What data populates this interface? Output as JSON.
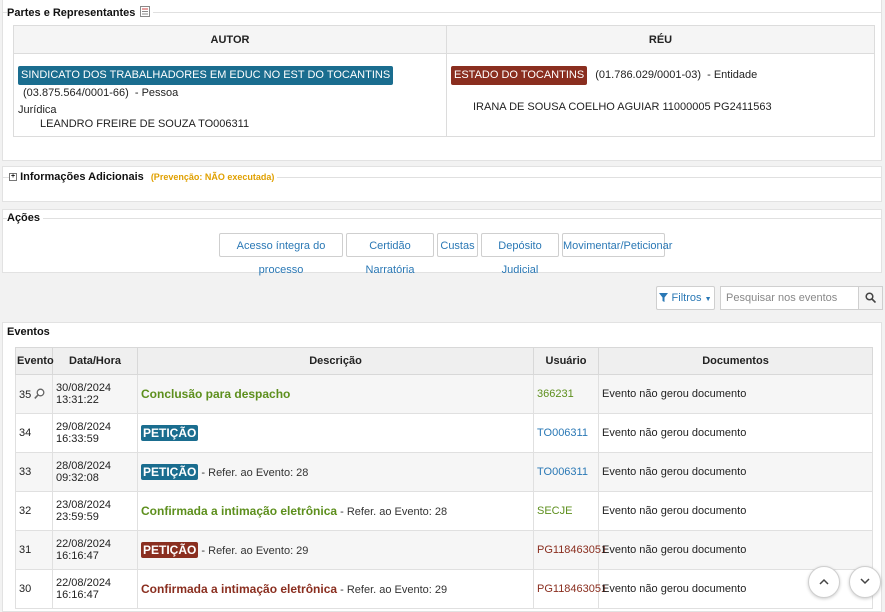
{
  "partes": {
    "title": "Partes e Representantes",
    "autor_header": "AUTOR",
    "reu_header": "RÉU",
    "autor": {
      "name": "SINDICATO DOS TRABALHADORES EM EDUC NO EST DO TOCANTINS",
      "doc": "(03.875.564/0001-66)",
      "type_part1": "- Pessoa",
      "type_part2": "Jurídica",
      "representative": "LEANDRO FREIRE DE SOUZA   TO006311"
    },
    "reu": {
      "name": "ESTADO DO TOCANTINS",
      "doc": "(01.786.029/0001-03)",
      "type": "- Entidade",
      "representative": "IRANA DE SOUSA COELHO AGUIAR   11000005   PG2411563"
    }
  },
  "info": {
    "title": "Informações Adicionais",
    "prevencao": "(Prevenção:  NÃO executada)"
  },
  "acoes": {
    "title": "Ações",
    "buttons": [
      "Acesso íntegra do processo",
      "Certidão Narratória",
      "Custas",
      "Depósito Judicial",
      "Movimentar/Peticionar"
    ]
  },
  "filters": {
    "label": "Filtros",
    "search_placeholder": "Pesquisar nos eventos"
  },
  "eventos": {
    "title": "Eventos",
    "headers": [
      "Evento",
      "Data/Hora",
      "Descrição",
      "Usuário",
      "Documentos"
    ],
    "rows": [
      {
        "num": "35",
        "date": "30/08/2024",
        "time": "13:31:22",
        "desc": "Conclusão para despacho",
        "refer": "",
        "user": "366231",
        "docs": "Evento não gerou documento"
      },
      {
        "num": "34",
        "date": "29/08/2024",
        "time": "16:33:59",
        "desc": "PETIÇÃO",
        "refer": "",
        "user": "TO006311",
        "docs": "Evento não gerou documento"
      },
      {
        "num": "33",
        "date": "28/08/2024",
        "time": "09:32:08",
        "desc": "PETIÇÃO",
        "refer": "- Refer. ao Evento: 28",
        "user": "TO006311",
        "docs": "Evento não gerou documento"
      },
      {
        "num": "32",
        "date": "23/08/2024",
        "time": "23:59:59",
        "desc": "Confirmada a intimação eletrônica",
        "refer": "- Refer. ao Evento: 28",
        "user": "SECJE",
        "docs": "Evento não gerou documento"
      },
      {
        "num": "31",
        "date": "22/08/2024",
        "time": "16:16:47",
        "desc": "PETIÇÃO",
        "refer": "- Refer. ao Evento: 29",
        "user": "PG118463051",
        "docs": "Evento não gerou documento"
      },
      {
        "num": "30",
        "date": "22/08/2024",
        "time": "16:16:47",
        "desc": "Confirmada a intimação eletrônica",
        "refer": "- Refer. ao Evento: 29",
        "user": "PG118463051",
        "docs": "Evento não gerou documento"
      }
    ]
  }
}
